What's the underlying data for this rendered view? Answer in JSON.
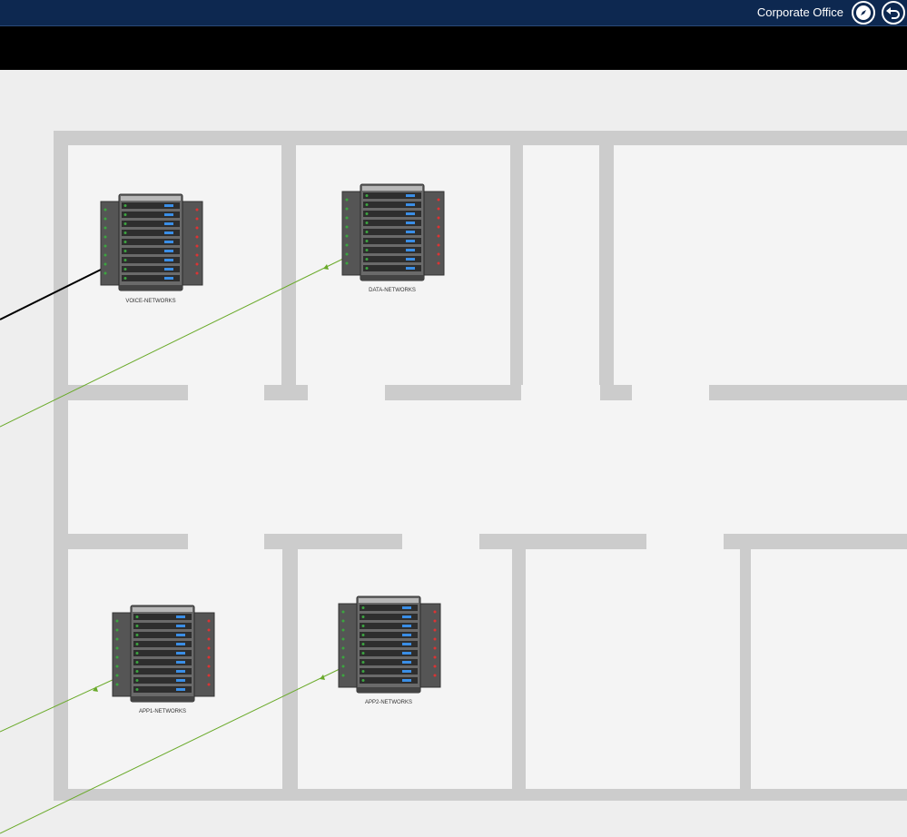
{
  "header": {
    "location_title": "Corporate Office",
    "navigate_icon": "compass-icon",
    "back_icon": "undo-arrow-icon",
    "background_color": "#0d2850"
  },
  "floor_plan": {
    "wall_color": "#cccccc",
    "room_color": "#f4f4f4",
    "link_color": "#6aaa2a",
    "alert_link_color": "#000000"
  },
  "servers": [
    {
      "label": "VOICE-NETWORKS",
      "icon": "server-rack-icon"
    },
    {
      "label": "DATA-NETWORKS",
      "icon": "server-rack-icon"
    },
    {
      "label": "APP1-NETWORKS",
      "icon": "server-rack-icon"
    },
    {
      "label": "APP2-NETWORKS",
      "icon": "server-rack-icon"
    }
  ]
}
